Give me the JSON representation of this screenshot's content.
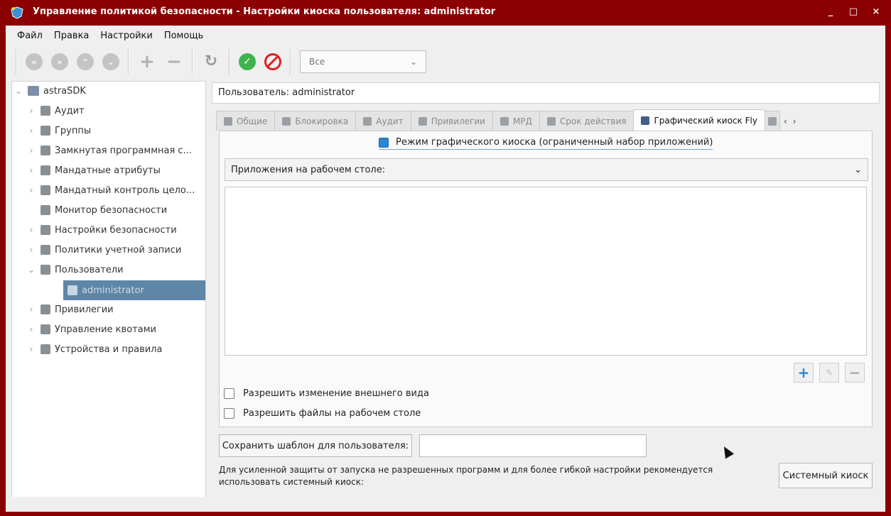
{
  "window": {
    "title": "Управление политикой безопасности - Настройки киоска пользователя: administrator",
    "controls": {
      "minimize": "_",
      "maximize": "□",
      "close": "×"
    }
  },
  "menu": [
    "Файл",
    "Правка",
    "Настройки",
    "Помощь"
  ],
  "toolbar": {
    "filter_value": "Все",
    "icons": [
      "back-icon",
      "forward-icon",
      "up-icon",
      "down-icon",
      "add-icon",
      "remove-icon",
      "refresh-icon",
      "apply-icon",
      "cancel-icon"
    ]
  },
  "tree": {
    "root": "astraSDK",
    "items": [
      {
        "label": "Аудит",
        "icon": "audit-icon"
      },
      {
        "label": "Группы",
        "icon": "groups-icon"
      },
      {
        "label": "Замкнутая программная с...",
        "icon": "closed-env-icon"
      },
      {
        "label": "Мандатные атрибуты",
        "icon": "mandatory-attrs-icon"
      },
      {
        "label": "Мандатный контроль цело...",
        "icon": "integrity-control-icon"
      },
      {
        "label": "Монитор безопасности",
        "icon": "security-monitor-icon"
      },
      {
        "label": "Настройки безопасности",
        "icon": "security-settings-icon"
      },
      {
        "label": "Политики учетной записи",
        "icon": "account-policies-icon"
      },
      {
        "label": "Пользователи",
        "icon": "users-icon"
      },
      {
        "label": "administrator",
        "icon": "user-icon"
      },
      {
        "label": "Привилегии",
        "icon": "privileges-icon"
      },
      {
        "label": "Управление квотами",
        "icon": "quota-icon"
      },
      {
        "label": "Устройства и правила",
        "icon": "devices-icon"
      }
    ]
  },
  "user_field": "Пользователь: administrator",
  "tabs": [
    "Общие",
    "Блокировка",
    "Аудит",
    "Привилегии",
    "МРД",
    "Срок действия",
    "Графический киоск Fly"
  ],
  "panel": {
    "kiosk_mode_label": "Режим графического киоска (ограниченный набор приложений)",
    "apps_combo": "Приложения на рабочем столе:",
    "allow_appearance": "Разрешить изменение внешнего вида",
    "allow_desktop_files": "Разрешить файлы на рабочем столе"
  },
  "save_template_button": "Сохранить шаблон для пользователя:",
  "info_text": "Для усиленной защиты от запуска не разрешенных программ и для более гибкой настройки рекомендуется использовать системный киоск:",
  "system_kiosk_button": "Системный киоск",
  "colors": {
    "titlebar": "#8b0000",
    "selection": "#5e86a6",
    "accent": "#2b86d6"
  }
}
